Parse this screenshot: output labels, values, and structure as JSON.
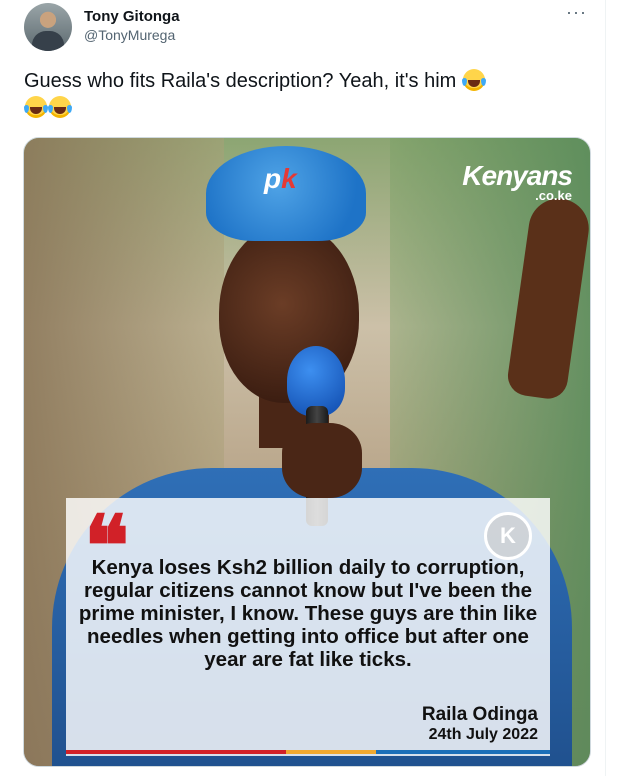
{
  "author": {
    "display_name": "Tony Gitonga",
    "handle": "@TonyMurega"
  },
  "more_menu": "···",
  "tweet": {
    "text": "Guess who fits Raila's description? Yeah, it's him",
    "emojis": [
      "face-with-tears-of-joy",
      "face-with-tears-of-joy",
      "face-with-tears-of-joy"
    ]
  },
  "media": {
    "brand_main": "Kenyans",
    "brand_sub": ".co.ke",
    "cap_logo_a": "p",
    "cap_logo_b": "k",
    "badge": "K",
    "quote_mark": "❝",
    "quote": "Kenya loses Ksh2 billion daily to corruption, regular citizens cannot know but I've been the prime minister, I know. These guys are thin like needles when getting into office but after one year are fat like ticks.",
    "attribution_name": "Raila Odinga",
    "attribution_date": "24th July 2022"
  },
  "colors": {
    "quote_red": "#d12128",
    "stripe_yellow": "#f0a830",
    "stripe_blue": "#1c6fb8"
  }
}
